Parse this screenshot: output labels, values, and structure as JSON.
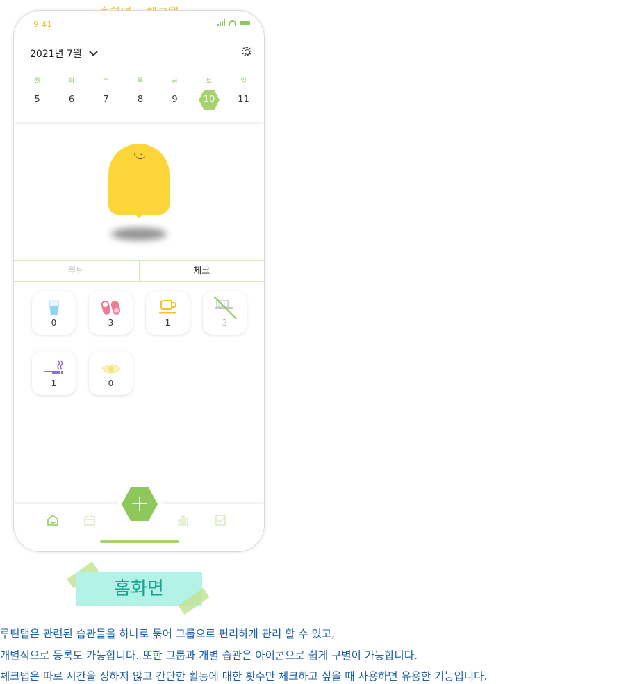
{
  "caption_top": {
    "left": "홈화면",
    "right": "체크탭"
  },
  "status": {
    "time": "9:41"
  },
  "header": {
    "month": "2021년 7월"
  },
  "week": [
    {
      "name": "월",
      "num": "5",
      "selected": false
    },
    {
      "name": "화",
      "num": "6",
      "selected": false
    },
    {
      "name": "수",
      "num": "7",
      "selected": false
    },
    {
      "name": "목",
      "num": "8",
      "selected": false
    },
    {
      "name": "금",
      "num": "9",
      "selected": false
    },
    {
      "name": "토",
      "num": "10",
      "selected": true
    },
    {
      "name": "일",
      "num": "11",
      "selected": false
    }
  ],
  "tabs": {
    "routine": "루틴",
    "check": "체크"
  },
  "check_items": [
    {
      "icon": "water-glass-icon",
      "count": "0",
      "active": true
    },
    {
      "icon": "pills-icon",
      "count": "3",
      "active": true
    },
    {
      "icon": "coffee-cup-icon",
      "count": "1",
      "active": true
    },
    {
      "icon": "toothbrush-icon",
      "count": "3",
      "active": false
    },
    {
      "icon": "cigarette-icon",
      "count": "1",
      "active": true
    },
    {
      "icon": "eye-icon",
      "count": "0",
      "active": true
    }
  ],
  "bottom_nav": {
    "items": [
      "home-icon",
      "calendar-icon",
      "add-icon",
      "stats-icon",
      "note-icon"
    ],
    "add_label": "+"
  },
  "section_label": "홈화면",
  "description": [
    "루틴탭은 관련된 습관들을 하나로 묶어 그룹으로 편리하게 관리 할 수 있고,",
    "개별적으로 등록도 가능합니다. 또한 그룹과 개별 습관은 아이콘으로 쉽게 구별이 가능합니다.",
    "체크탭은 따로 시간을 정하지 않고 간단한 활동에 대한 횟수만 체크하고 싶을 때 사용하면 유용한 기능입니다."
  ],
  "colors": {
    "accent_green": "#8fc85a",
    "accent_yellow": "#f1c232",
    "mascot": "#fcd538",
    "label_bg": "#b3f2e6",
    "desc_text": "#1b5fa8"
  }
}
